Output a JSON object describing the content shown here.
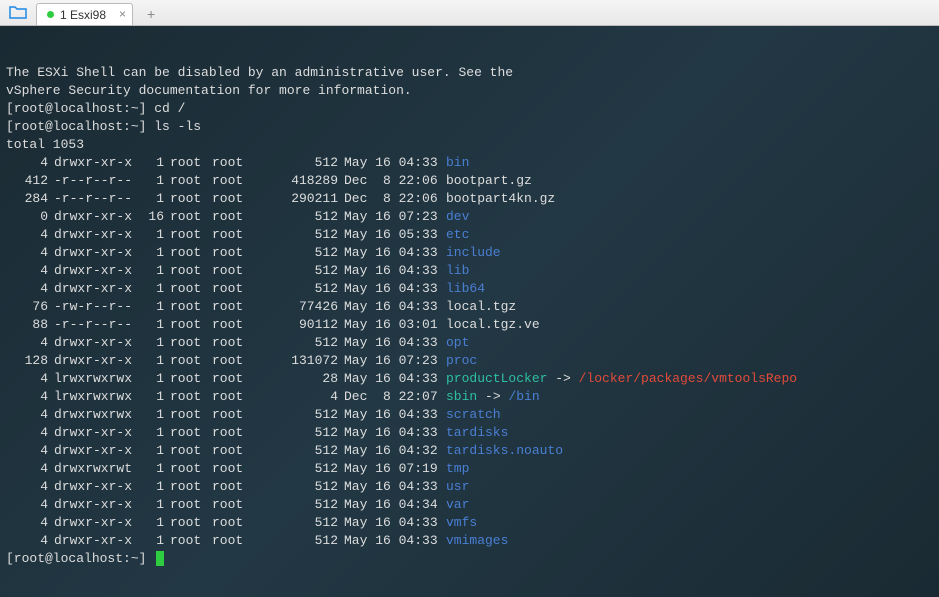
{
  "tab": {
    "label": "1 Esxi98"
  },
  "header": {
    "msg1": "The ESXi Shell can be disabled by an administrative user. See the",
    "msg2": "vSphere Security documentation for more information."
  },
  "prompts": {
    "p1": "[root@localhost:~] cd /",
    "p2": "[root@localhost:~] ls -ls",
    "p3": "[root@localhost:~] "
  },
  "total": "total 1053",
  "rows": [
    {
      "blocks": "4",
      "perm": "drwxr-xr-x",
      "links": "1",
      "owner": "root",
      "group": "root",
      "size": "512",
      "date": "May 16 04:33",
      "name": "bin",
      "cls": "dir"
    },
    {
      "blocks": "412",
      "perm": "-r--r--r--",
      "links": "1",
      "owner": "root",
      "group": "root",
      "size": "418289",
      "date": "Dec  8 22:06",
      "name": "bootpart.gz",
      "cls": "file"
    },
    {
      "blocks": "284",
      "perm": "-r--r--r--",
      "links": "1",
      "owner": "root",
      "group": "root",
      "size": "290211",
      "date": "Dec  8 22:06",
      "name": "bootpart4kn.gz",
      "cls": "file"
    },
    {
      "blocks": "0",
      "perm": "drwxr-xr-x",
      "links": "16",
      "owner": "root",
      "group": "root",
      "size": "512",
      "date": "May 16 07:23",
      "name": "dev",
      "cls": "dir"
    },
    {
      "blocks": "4",
      "perm": "drwxr-xr-x",
      "links": "1",
      "owner": "root",
      "group": "root",
      "size": "512",
      "date": "May 16 05:33",
      "name": "etc",
      "cls": "dir"
    },
    {
      "blocks": "4",
      "perm": "drwxr-xr-x",
      "links": "1",
      "owner": "root",
      "group": "root",
      "size": "512",
      "date": "May 16 04:33",
      "name": "include",
      "cls": "dir"
    },
    {
      "blocks": "4",
      "perm": "drwxr-xr-x",
      "links": "1",
      "owner": "root",
      "group": "root",
      "size": "512",
      "date": "May 16 04:33",
      "name": "lib",
      "cls": "dir"
    },
    {
      "blocks": "4",
      "perm": "drwxr-xr-x",
      "links": "1",
      "owner": "root",
      "group": "root",
      "size": "512",
      "date": "May 16 04:33",
      "name": "lib64",
      "cls": "dir"
    },
    {
      "blocks": "76",
      "perm": "-rw-r--r--",
      "links": "1",
      "owner": "root",
      "group": "root",
      "size": "77426",
      "date": "May 16 04:33",
      "name": "local.tgz",
      "cls": "file"
    },
    {
      "blocks": "88",
      "perm": "-r--r--r--",
      "links": "1",
      "owner": "root",
      "group": "root",
      "size": "90112",
      "date": "May 16 03:01",
      "name": "local.tgz.ve",
      "cls": "file"
    },
    {
      "blocks": "4",
      "perm": "drwxr-xr-x",
      "links": "1",
      "owner": "root",
      "group": "root",
      "size": "512",
      "date": "May 16 04:33",
      "name": "opt",
      "cls": "dir"
    },
    {
      "blocks": "128",
      "perm": "drwxr-xr-x",
      "links": "1",
      "owner": "root",
      "group": "root",
      "size": "131072",
      "date": "May 16 07:23",
      "name": "proc",
      "cls": "dir"
    },
    {
      "blocks": "4",
      "perm": "lrwxrwxrwx",
      "links": "1",
      "owner": "root",
      "group": "root",
      "size": "28",
      "date": "May 16 04:33",
      "name": "productLocker",
      "cls": "link",
      "arrow": " -> ",
      "target": "/locker/packages/vmtoolsRepo",
      "tcls": "red"
    },
    {
      "blocks": "4",
      "perm": "lrwxrwxrwx",
      "links": "1",
      "owner": "root",
      "group": "root",
      "size": "4",
      "date": "Dec  8 22:07",
      "name": "sbin",
      "cls": "link",
      "arrow": " -> ",
      "target": "/bin",
      "tcls": "blue"
    },
    {
      "blocks": "4",
      "perm": "drwxrwxrwx",
      "links": "1",
      "owner": "root",
      "group": "root",
      "size": "512",
      "date": "May 16 04:33",
      "name": "scratch",
      "cls": "dir"
    },
    {
      "blocks": "4",
      "perm": "drwxr-xr-x",
      "links": "1",
      "owner": "root",
      "group": "root",
      "size": "512",
      "date": "May 16 04:33",
      "name": "tardisks",
      "cls": "dir"
    },
    {
      "blocks": "4",
      "perm": "drwxr-xr-x",
      "links": "1",
      "owner": "root",
      "group": "root",
      "size": "512",
      "date": "May 16 04:32",
      "name": "tardisks.noauto",
      "cls": "dir"
    },
    {
      "blocks": "4",
      "perm": "drwxrwxrwt",
      "links": "1",
      "owner": "root",
      "group": "root",
      "size": "512",
      "date": "May 16 07:19",
      "name": "tmp",
      "cls": "dir"
    },
    {
      "blocks": "4",
      "perm": "drwxr-xr-x",
      "links": "1",
      "owner": "root",
      "group": "root",
      "size": "512",
      "date": "May 16 04:33",
      "name": "usr",
      "cls": "dir"
    },
    {
      "blocks": "4",
      "perm": "drwxr-xr-x",
      "links": "1",
      "owner": "root",
      "group": "root",
      "size": "512",
      "date": "May 16 04:34",
      "name": "var",
      "cls": "dir"
    },
    {
      "blocks": "4",
      "perm": "drwxr-xr-x",
      "links": "1",
      "owner": "root",
      "group": "root",
      "size": "512",
      "date": "May 16 04:33",
      "name": "vmfs",
      "cls": "dir"
    },
    {
      "blocks": "4",
      "perm": "drwxr-xr-x",
      "links": "1",
      "owner": "root",
      "group": "root",
      "size": "512",
      "date": "May 16 04:33",
      "name": "vmimages",
      "cls": "dir"
    }
  ]
}
